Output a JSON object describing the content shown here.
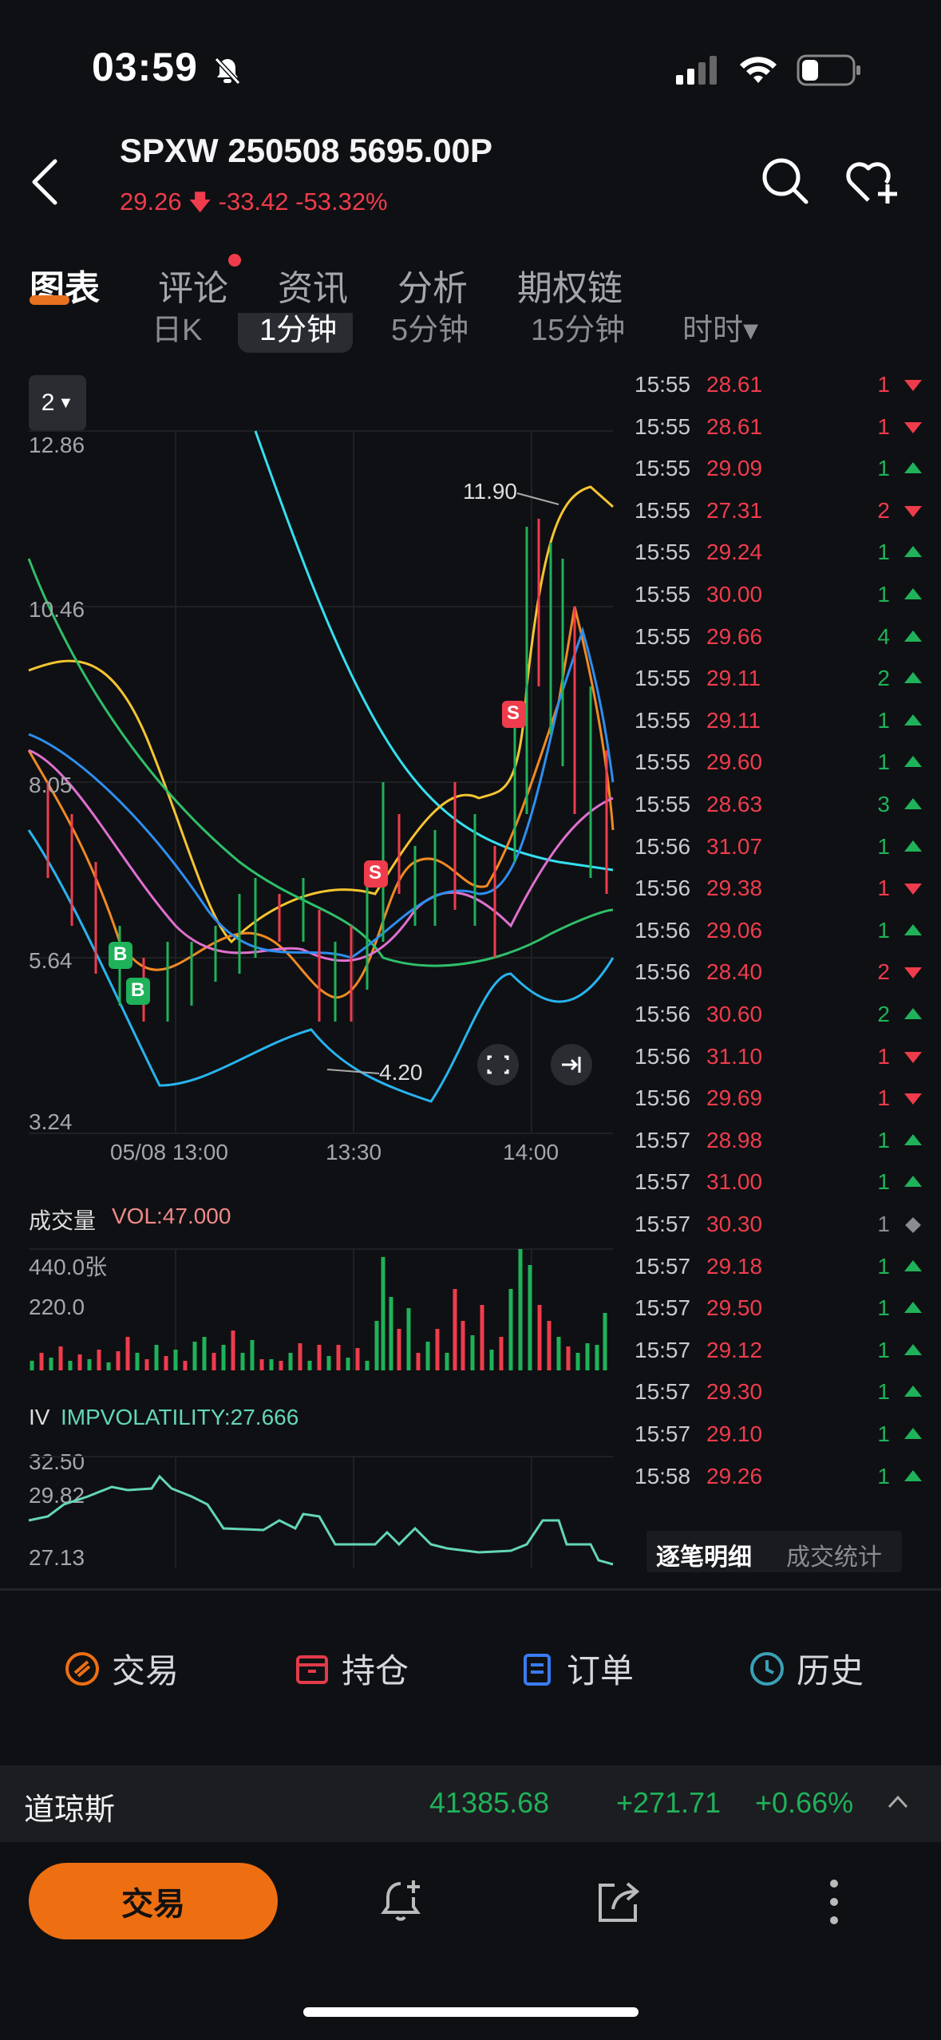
{
  "status": {
    "time": "03:59"
  },
  "header": {
    "title": "SPXW 250508 5695.00P",
    "price": "29.26",
    "change": "-33.42",
    "change_pct": "-53.32%"
  },
  "tabs": [
    "图表",
    "评论",
    "资讯",
    "分析",
    "期权链"
  ],
  "subtabs": [
    "日K",
    "1分钟",
    "5分钟",
    "15分钟",
    "时时▾"
  ],
  "chart": {
    "period_selector": "2",
    "y_labels": [
      "12.86",
      "10.46",
      "8.05",
      "5.64",
      "3.24"
    ],
    "x_labels": [
      "05/08 13:00",
      "13:30",
      "14:00"
    ],
    "annotation_high": "11.90",
    "annotation_low": "4.20",
    "marker_b": "B",
    "marker_s": "S"
  },
  "volume": {
    "title": "成交量",
    "value_label": "VOL:47.000",
    "y_labels": [
      "440.0张",
      "220.0"
    ]
  },
  "iv": {
    "title": "IV",
    "value_label": "IMPVOLATILITY:27.666",
    "y_labels": [
      "32.50",
      "29.82",
      "27.13"
    ]
  },
  "ticks": [
    {
      "time": "15:55",
      "price": "28.61",
      "qty": "1",
      "dir": "down"
    },
    {
      "time": "15:55",
      "price": "28.61",
      "qty": "1",
      "dir": "down"
    },
    {
      "time": "15:55",
      "price": "29.09",
      "qty": "1",
      "dir": "up"
    },
    {
      "time": "15:55",
      "price": "27.31",
      "qty": "2",
      "dir": "down"
    },
    {
      "time": "15:55",
      "price": "29.24",
      "qty": "1",
      "dir": "up"
    },
    {
      "time": "15:55",
      "price": "30.00",
      "qty": "1",
      "dir": "up"
    },
    {
      "time": "15:55",
      "price": "29.66",
      "qty": "4",
      "dir": "up"
    },
    {
      "time": "15:55",
      "price": "29.11",
      "qty": "2",
      "dir": "up"
    },
    {
      "time": "15:55",
      "price": "29.11",
      "qty": "1",
      "dir": "up"
    },
    {
      "time": "15:55",
      "price": "29.60",
      "qty": "1",
      "dir": "up"
    },
    {
      "time": "15:55",
      "price": "28.63",
      "qty": "3",
      "dir": "up"
    },
    {
      "time": "15:56",
      "price": "31.07",
      "qty": "1",
      "dir": "up"
    },
    {
      "time": "15:56",
      "price": "29.38",
      "qty": "1",
      "dir": "down"
    },
    {
      "time": "15:56",
      "price": "29.06",
      "qty": "1",
      "dir": "up"
    },
    {
      "time": "15:56",
      "price": "28.40",
      "qty": "2",
      "dir": "down"
    },
    {
      "time": "15:56",
      "price": "30.60",
      "qty": "2",
      "dir": "up"
    },
    {
      "time": "15:56",
      "price": "31.10",
      "qty": "1",
      "dir": "down"
    },
    {
      "time": "15:56",
      "price": "29.69",
      "qty": "1",
      "dir": "down"
    },
    {
      "time": "15:57",
      "price": "28.98",
      "qty": "1",
      "dir": "up"
    },
    {
      "time": "15:57",
      "price": "31.00",
      "qty": "1",
      "dir": "up"
    },
    {
      "time": "15:57",
      "price": "30.30",
      "qty": "1",
      "dir": "neutral"
    },
    {
      "time": "15:57",
      "price": "29.18",
      "qty": "1",
      "dir": "up"
    },
    {
      "time": "15:57",
      "price": "29.50",
      "qty": "1",
      "dir": "up"
    },
    {
      "time": "15:57",
      "price": "29.12",
      "qty": "1",
      "dir": "up"
    },
    {
      "time": "15:57",
      "price": "29.30",
      "qty": "1",
      "dir": "up"
    },
    {
      "time": "15:57",
      "price": "29.10",
      "qty": "1",
      "dir": "up"
    },
    {
      "time": "15:58",
      "price": "29.26",
      "qty": "1",
      "dir": "up"
    }
  ],
  "tick_tabs": [
    "逐笔明细",
    "成交统计"
  ],
  "actions": [
    {
      "label": "交易",
      "icon": "trade-icon",
      "color": "#ee6f12"
    },
    {
      "label": "持仓",
      "icon": "position-icon",
      "color": "#e23b4a"
    },
    {
      "label": "订单",
      "icon": "order-icon",
      "color": "#3a7bf2"
    },
    {
      "label": "历史",
      "icon": "history-icon",
      "color": "#3aa0b8"
    }
  ],
  "index_bar": {
    "name": "道琼斯",
    "value": "41385.68",
    "change": "+271.71",
    "change_pct": "+0.66%"
  },
  "bottom": {
    "trade_label": "交易"
  },
  "colors": {
    "up": "#1fb25a",
    "down": "#ef3c4c",
    "accent": "#ee6f12",
    "neutral": "#8a8c92"
  }
}
